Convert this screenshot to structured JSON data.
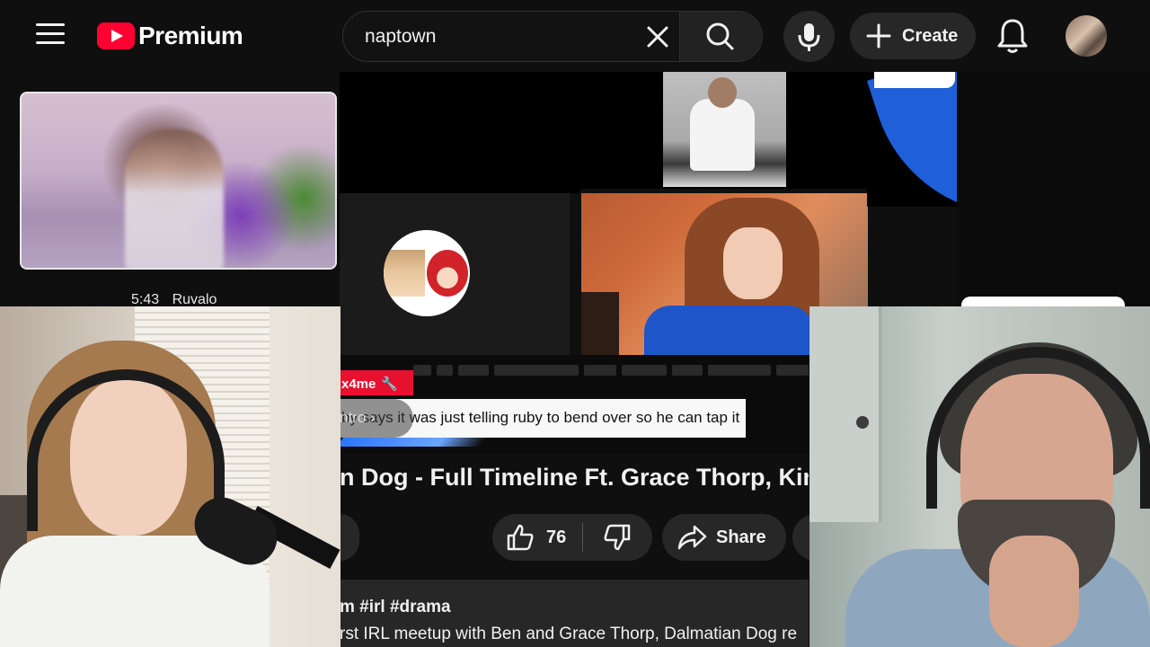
{
  "header": {
    "brand": "Premium",
    "search_value": "naptown",
    "create_label": "Create"
  },
  "thumbnail": {
    "duration": "5:43",
    "channel": "Ruvalo"
  },
  "player": {
    "channel_tag": "x4me",
    "chapter_chip": "ntro",
    "caption": "by says it was just telling ruby to bend over so he can tap it"
  },
  "video": {
    "title": "n Dog - Full Timeline Ft. Grace Thorp, King",
    "likes": "76",
    "share_label": "Share",
    "description_tags": "m #irl #drama",
    "description_text": "rst IRL meetup with Ben and Grace Thorp, Dalmatian Dog re"
  },
  "colors": {
    "background": "#0f0f0f",
    "brand_red": "#ff0033",
    "chip": "#272727",
    "accent_blue": "#1f5fd8"
  },
  "icons": [
    "menu-icon",
    "youtube-logo-icon",
    "clear-icon",
    "search-icon",
    "mic-icon",
    "plus-icon",
    "bell-icon",
    "like-icon",
    "dislike-icon",
    "share-icon",
    "wrench-icon",
    "chevron-right-icon"
  ]
}
